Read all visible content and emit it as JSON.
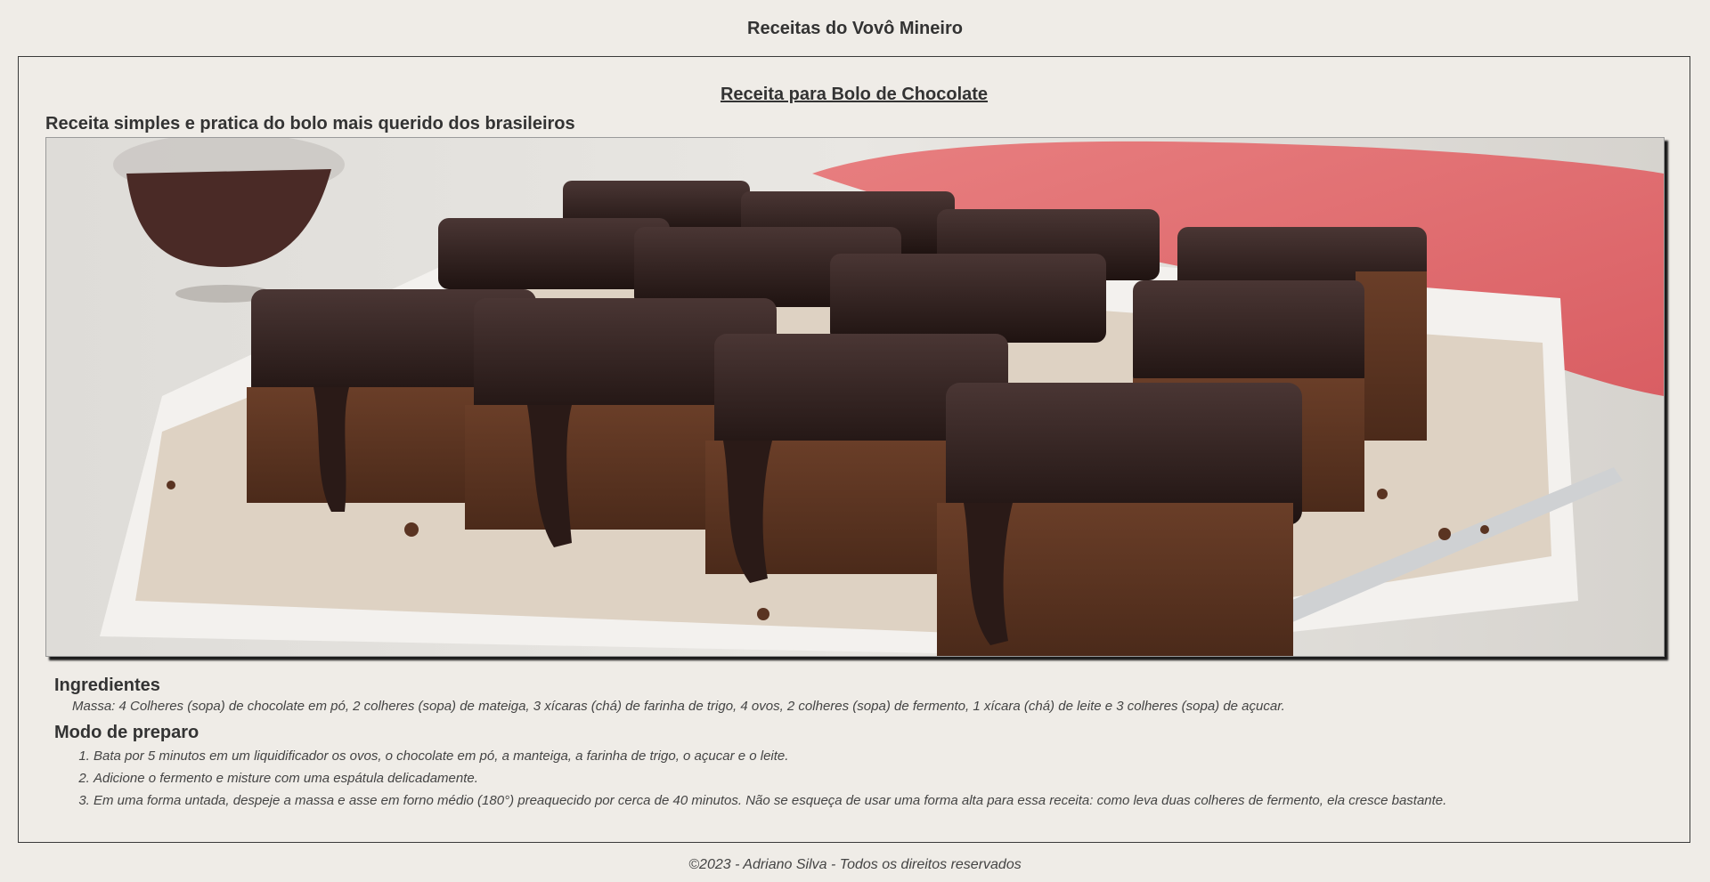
{
  "site": {
    "title": "Receitas do Vovô Mineiro"
  },
  "recipe": {
    "title": "Receita para Bolo de Chocolate",
    "subtitle": "Receita simples e pratica do bolo mais querido dos brasileiros",
    "ingredients_heading": "Ingredientes",
    "ingredients_text": "Massa: 4 Colheres (sopa) de chocolate em pó, 2 colheres (sopa) de mateiga, 3 xícaras (chá) de farinha de trigo, 4 ovos, 2 colheres (sopa) de fermento, 1 xícara (chá) de leite e 3 colheres (sopa) de açucar.",
    "preparation_heading": "Modo de preparo",
    "steps": [
      "Bata por 5 minutos em um liquidificador os ovos, o chocolate em pó, a manteiga, a farinha de trigo, o açucar e o leite.",
      "Adicione o fermento e misture com uma espátula delicadamente.",
      "Em uma forma untada, despeje a massa e asse em forno médio (180°) preaquecido por cerca de 40 minutos. Não se esqueça de usar uma forma alta para essa receita: como leva duas colheres de fermento, ela cresce bastante."
    ]
  },
  "footer": {
    "text": "©2023 - Adriano Silva - Todos os direitos reservados"
  },
  "colors": {
    "background": "#efece7",
    "text": "#333333",
    "border": "#3a3a3a",
    "cake": "#5a3422",
    "frosting": "#2a1a17",
    "towel": "#e0787a"
  }
}
